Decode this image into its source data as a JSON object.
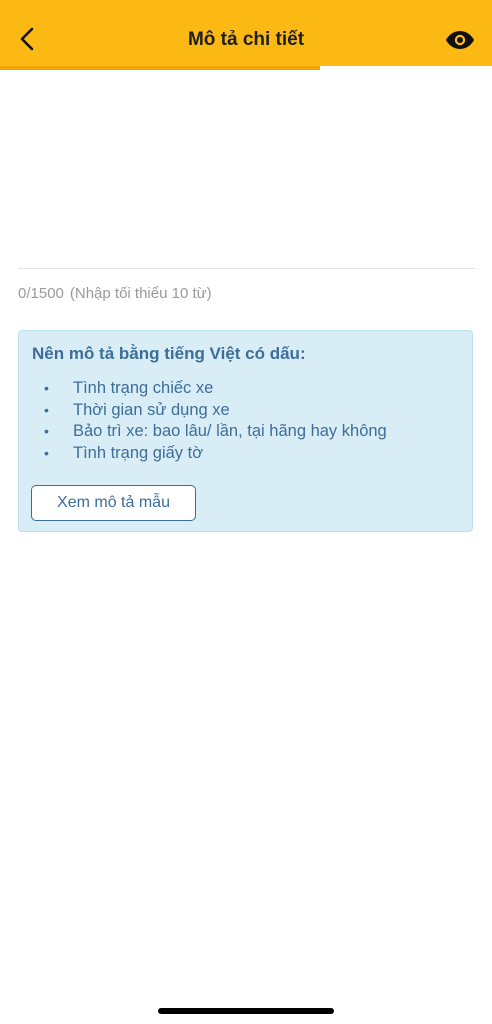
{
  "header": {
    "title": "Mô tả chi tiết",
    "back_icon": "chevron-left-icon",
    "preview_icon": "eye-icon",
    "background_color": "#FDB913",
    "progress_color": "#F0A500",
    "progress_fraction": 0.65
  },
  "editor": {
    "value": "",
    "counter": "0/1500",
    "hint": "(Nhập tối thiểu 10 từ)"
  },
  "tips": {
    "heading": "Nên mô tả bằng tiếng Việt có dấu:",
    "bullet": "•",
    "items": [
      "Tình trạng chiếc xe",
      "Thời gian sử dụng xe",
      "Bảo trì xe: bao lâu/ lần, tại hãng hay không",
      "Tình trạng giấy tờ"
    ],
    "sample_button": "Xem mô tả mẫu",
    "background_color": "#D9EDF7",
    "text_color": "#3C6E99"
  }
}
